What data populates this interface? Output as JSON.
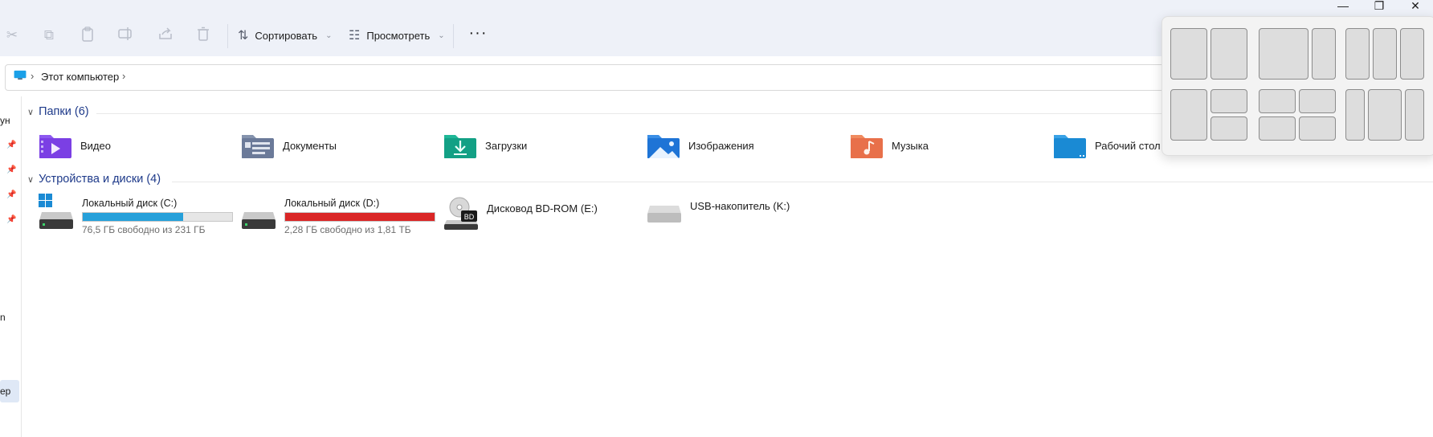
{
  "toolbar": {
    "actions": [
      {
        "name": "cut",
        "icon": "scissors-icon",
        "glyph": "✂"
      },
      {
        "name": "copy",
        "icon": "copy-icon",
        "glyph": "⧉"
      },
      {
        "name": "paste",
        "icon": "paste-icon",
        "glyph": "▭"
      },
      {
        "name": "rename",
        "icon": "rename-icon",
        "glyph": "▢"
      },
      {
        "name": "share",
        "icon": "share-icon",
        "glyph": "⇪"
      },
      {
        "name": "delete",
        "icon": "trash-icon",
        "glyph": "🗑"
      }
    ],
    "sort_label": "Сортировать",
    "view_label": "Просмотреть",
    "more_label": "···"
  },
  "window_controls": {
    "minimize": "—",
    "restore": "❐",
    "close": "✕"
  },
  "address": {
    "location_icon": "this-pc-icon",
    "current": "Этот компьютер",
    "separator": "›"
  },
  "nav": {
    "fragments": [
      {
        "text": "ун"
      },
      {
        "text": "n"
      },
      {
        "text": "ер"
      }
    ]
  },
  "folders_section": {
    "title": "Папки (6)",
    "items": [
      {
        "label": "Видео",
        "icon": "videos-folder-icon",
        "color": "#7b3fe4"
      },
      {
        "label": "Документы",
        "icon": "documents-folder-icon",
        "color": "#6b7a99"
      },
      {
        "label": "Загрузки",
        "icon": "downloads-folder-icon",
        "color": "#13a085"
      },
      {
        "label": "Изображения",
        "icon": "pictures-folder-icon",
        "color": "#1e74d6"
      },
      {
        "label": "Музыка",
        "icon": "music-folder-icon",
        "color": "#e8704a"
      },
      {
        "label": "Рабочий стол",
        "icon": "desktop-folder-icon",
        "color": "#1a8ad4"
      }
    ]
  },
  "devices_section": {
    "title": "Устройства и диски (4)",
    "items": [
      {
        "label": "Локальный диск (C:)",
        "free": "76,5 ГБ свободно из 231 ГБ",
        "used_fraction": 0.67,
        "bar_color": "#26a0da",
        "icon": "system-drive-icon"
      },
      {
        "label": "Локальный диск (D:)",
        "free": "2,28 ГБ свободно из 1,81 ТБ",
        "used_fraction": 0.999,
        "bar_color": "#da2626",
        "icon": "hard-drive-icon"
      },
      {
        "label": "Дисковод BD-ROM (E:)",
        "badge": "BD",
        "icon": "bd-rom-drive-icon"
      },
      {
        "label": "USB-накопитель (K:)",
        "icon": "usb-drive-icon"
      }
    ]
  },
  "snap_layouts": {
    "accent": "#dddddd"
  }
}
